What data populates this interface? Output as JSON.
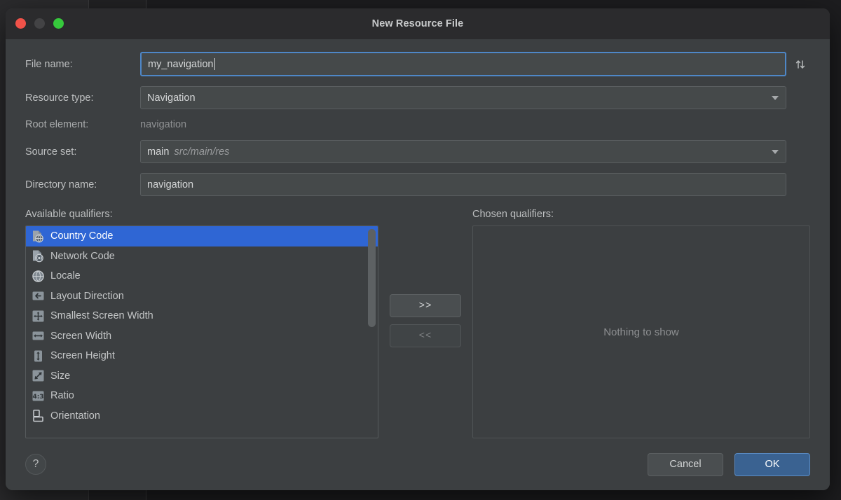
{
  "window": {
    "title": "New Resource File",
    "traffic_lights": [
      "close-button",
      "minimize-button",
      "maximize-button"
    ]
  },
  "form": {
    "file_name": {
      "label": "File name:",
      "value": "my_navigation"
    },
    "resource_type": {
      "label": "Resource type:",
      "value": "Navigation"
    },
    "root_element": {
      "label": "Root element:",
      "value": "navigation"
    },
    "source_set": {
      "label": "Source set:",
      "value": "main",
      "path": "src/main/res"
    },
    "directory_name": {
      "label": "Directory name:",
      "value": "navigation"
    },
    "sort_icon": "sort-arrows-icon"
  },
  "qualifiers": {
    "available_label": "Available qualifiers:",
    "chosen_label": "Chosen qualifiers:",
    "empty_text": "Nothing to show",
    "add_button": ">>",
    "remove_button": "<<",
    "available": [
      {
        "label": "Country Code",
        "icon": "country-code-icon",
        "selected": true
      },
      {
        "label": "Network Code",
        "icon": "network-code-icon",
        "selected": false
      },
      {
        "label": "Locale",
        "icon": "locale-globe-icon",
        "selected": false
      },
      {
        "label": "Layout Direction",
        "icon": "layout-direction-icon",
        "selected": false
      },
      {
        "label": "Smallest Screen Width",
        "icon": "smallest-screen-width-icon",
        "selected": false
      },
      {
        "label": "Screen Width",
        "icon": "screen-width-icon",
        "selected": false
      },
      {
        "label": "Screen Height",
        "icon": "screen-height-icon",
        "selected": false
      },
      {
        "label": "Size",
        "icon": "size-icon",
        "selected": false
      },
      {
        "label": "Ratio",
        "icon": "ratio-icon",
        "selected": false
      },
      {
        "label": "Orientation",
        "icon": "orientation-icon",
        "selected": false
      }
    ],
    "chosen": []
  },
  "footer": {
    "help": "?",
    "cancel": "Cancel",
    "ok": "OK"
  },
  "colors": {
    "accent_blue": "#2f66d4",
    "ok_button": "#3a6291",
    "focus_border": "#4e87c7",
    "dialog_bg": "#3c3f41",
    "titlebar_bg": "#2b2b2d"
  }
}
